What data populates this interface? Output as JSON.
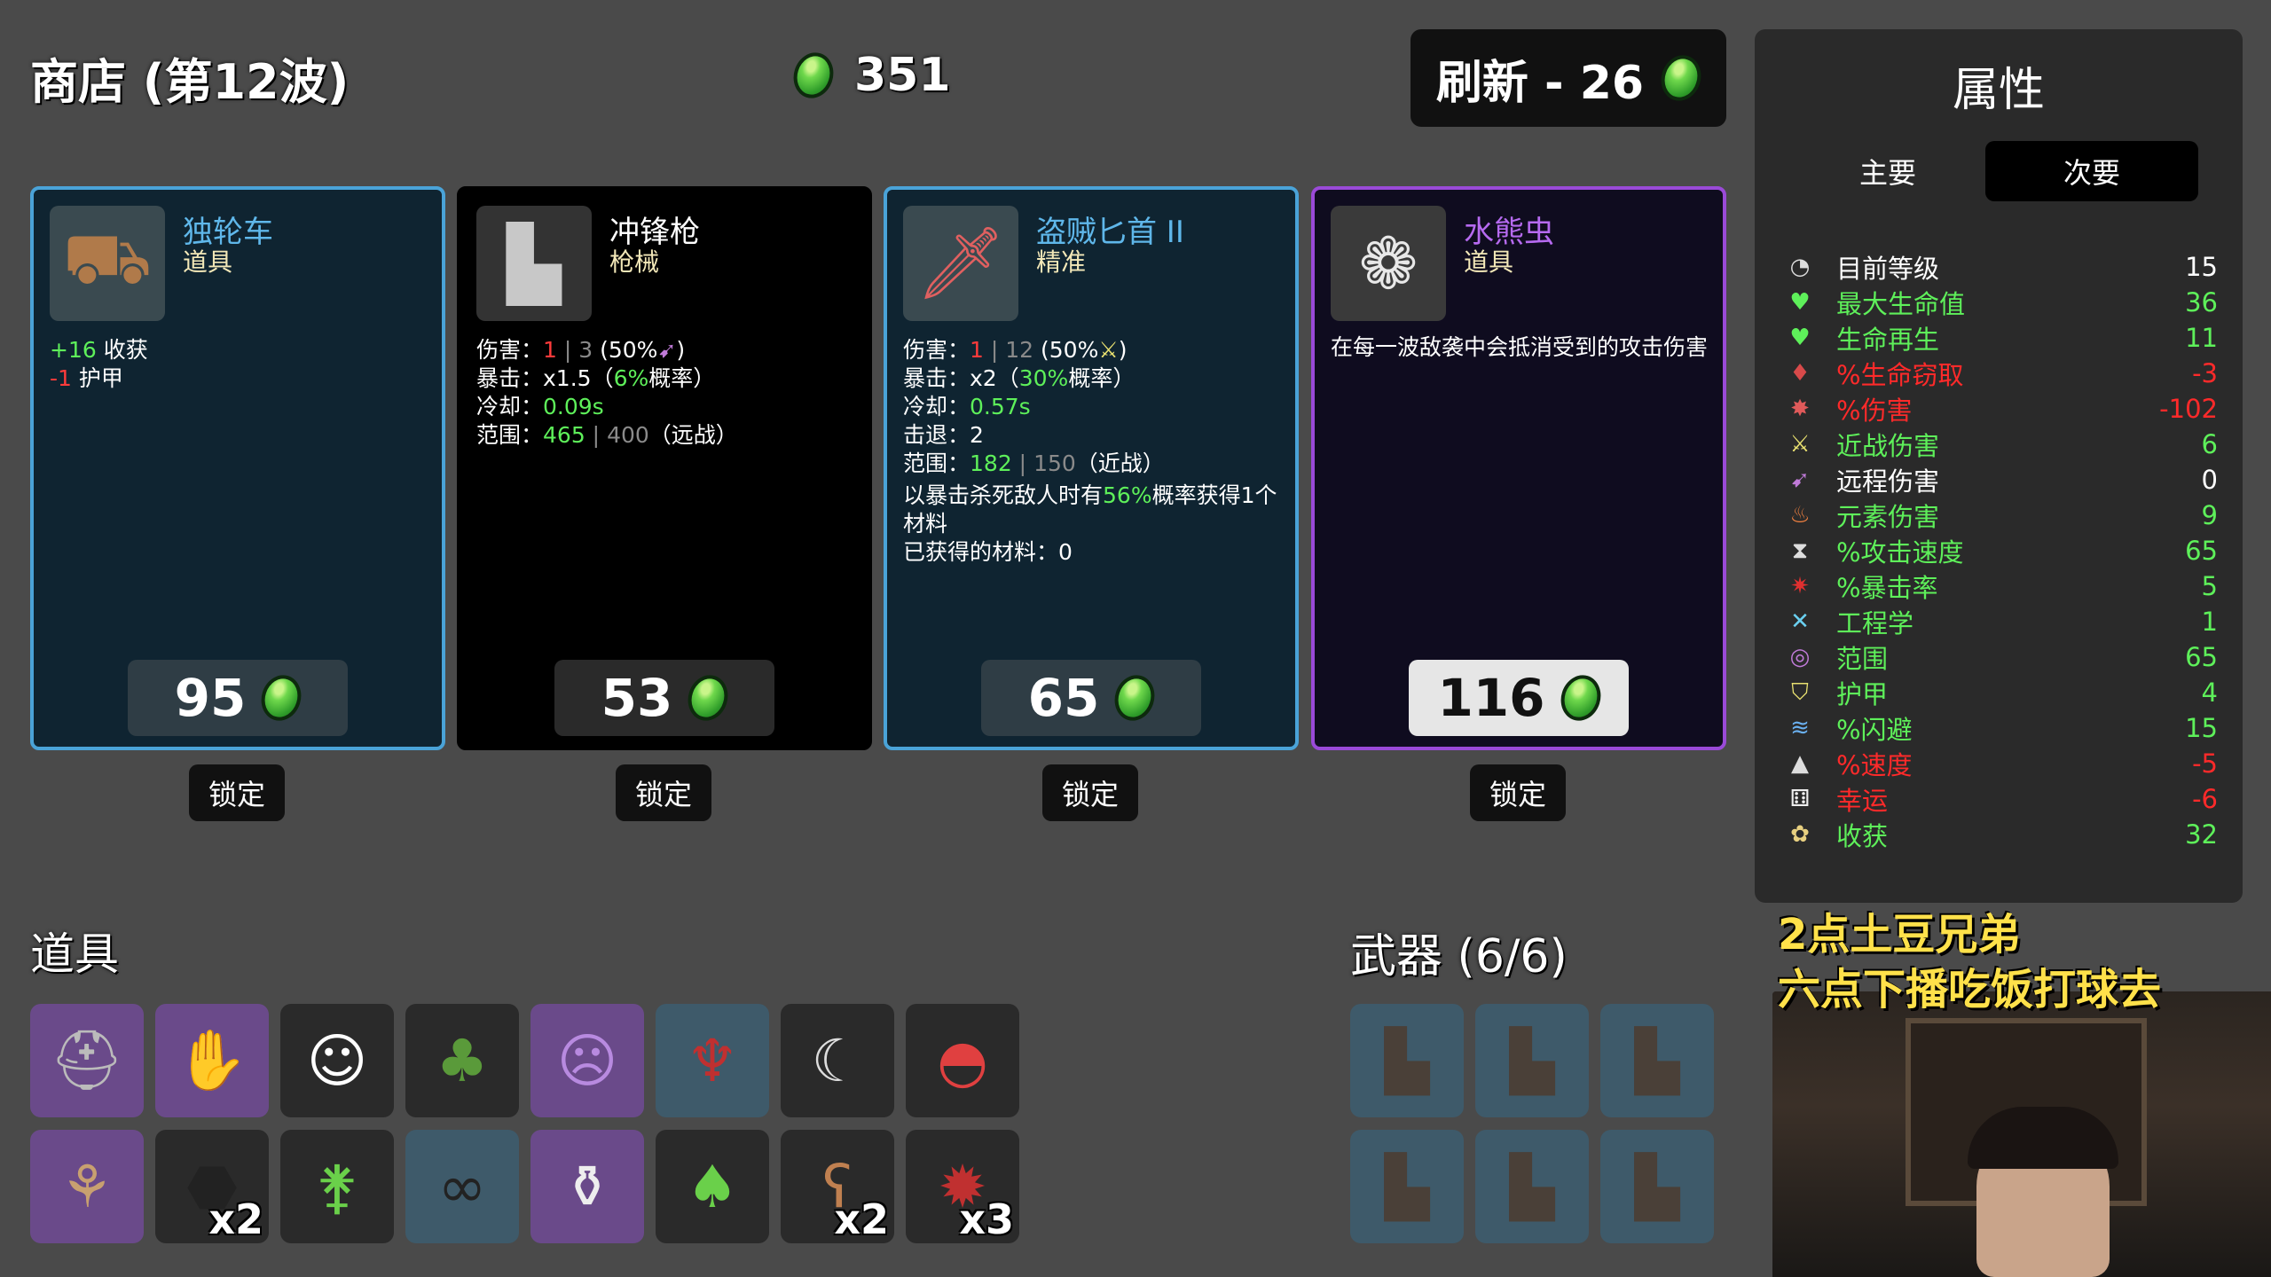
{
  "header": {
    "title": "商店 (第12波)",
    "gold": "351",
    "reroll_label": "刷新 - 26"
  },
  "shop": {
    "lock_label": "锁定",
    "cards": [
      {
        "name": "独轮车",
        "type": "道具",
        "price": "95",
        "icon": "wheelbarrow-icon",
        "lines": [
          {
            "a": "+16",
            "a_color": "green",
            "b": " 收获"
          },
          {
            "a": "-1",
            "a_color": "red",
            "b": " 护甲"
          }
        ]
      },
      {
        "name": "冲锋枪",
        "type": "枪械",
        "price": "53",
        "icon": "smg-icon",
        "lines": [
          {
            "label": "伤害：",
            "v1": "1",
            "v1c": "red",
            "sep": " | ",
            "v2": "3",
            "v2c": "gray",
            "rest": " (50%",
            "tail": ")"
          },
          {
            "label": "暴击：",
            "v1": "x1.5",
            "v1c": "white",
            "rest": "（",
            "v2": "6%",
            "v2c": "green",
            "tail": "概率）"
          },
          {
            "label": "冷却：",
            "v1": "0.09s",
            "v1c": "green"
          },
          {
            "label": "范围：",
            "v1": "465",
            "v1c": "green",
            "sep": " | ",
            "v2": "400",
            "v2c": "gray",
            "tail": "（远战）"
          }
        ]
      },
      {
        "name": "盗贼匕首 II",
        "type": "精准",
        "price": "65",
        "icon": "dagger-icon",
        "lines": [
          {
            "label": "伤害：",
            "v1": "1",
            "v1c": "red",
            "sep": " | ",
            "v2": "12",
            "v2c": "gray",
            "rest": " (50%",
            "tail": ")"
          },
          {
            "label": "暴击：",
            "v1": "x2",
            "v1c": "white",
            "rest": "（",
            "v2": "30%",
            "v2c": "green",
            "tail": "概率）"
          },
          {
            "label": "冷却：",
            "v1": "0.57s",
            "v1c": "green"
          },
          {
            "label": "击退：",
            "v1": "2",
            "v1c": "white"
          },
          {
            "label": "范围：",
            "v1": "182",
            "v1c": "green",
            "sep": " | ",
            "v2": "150",
            "v2c": "gray",
            "tail": "（近战）"
          }
        ],
        "extra_pre": "以暴击杀死敌人时有",
        "extra_pct": "56%",
        "extra_post": "概率获得1个材料",
        "extra2": "已获得的材料：0"
      },
      {
        "name": "水熊虫",
        "type": "道具",
        "price": "116",
        "icon": "tardigrade-icon",
        "desc": "在每一波敌袭中会抵消受到的攻击伤害"
      }
    ]
  },
  "stats": {
    "title": "属性",
    "tab_primary": "主要",
    "tab_secondary": "次要",
    "rows": [
      {
        "icon": "level-icon",
        "glyph": "◔",
        "label": "目前等级",
        "value": "15",
        "color": "#ffffff"
      },
      {
        "icon": "heart-icon",
        "glyph": "♥",
        "label": "最大生命值",
        "value": "36",
        "color": "#5ef05a"
      },
      {
        "icon": "regen-icon",
        "glyph": "♥",
        "label": "生命再生",
        "value": "11",
        "color": "#5ef05a"
      },
      {
        "icon": "lifesteal-icon",
        "glyph": "♦",
        "label": "%生命窃取",
        "value": "-3",
        "color": "#ff2a2a"
      },
      {
        "icon": "damage-icon",
        "glyph": "✸",
        "label": "%伤害",
        "value": "-102",
        "color": "#ff2a2a"
      },
      {
        "icon": "melee-icon",
        "glyph": "⚔",
        "label": "近战伤害",
        "value": "6",
        "color": "#5ef05a"
      },
      {
        "icon": "ranged-icon",
        "glyph": "➹",
        "label": "远程伤害",
        "value": "0",
        "color": "#ffffff"
      },
      {
        "icon": "elemental-icon",
        "glyph": "♨",
        "label": "元素伤害",
        "value": "9",
        "color": "#5ef05a"
      },
      {
        "icon": "attack-speed-icon",
        "glyph": "⧗",
        "label": "%攻击速度",
        "value": "65",
        "color": "#5ef05a"
      },
      {
        "icon": "crit-icon",
        "glyph": "✷",
        "label": "%暴击率",
        "value": "5",
        "color": "#5ef05a"
      },
      {
        "icon": "engineering-icon",
        "glyph": "✕",
        "label": "工程学",
        "value": "1",
        "color": "#5ef05a"
      },
      {
        "icon": "range-icon",
        "glyph": "◎",
        "label": "范围",
        "value": "65",
        "color": "#5ef05a"
      },
      {
        "icon": "armor-icon",
        "glyph": "⛉",
        "label": "护甲",
        "value": "4",
        "color": "#5ef05a"
      },
      {
        "icon": "dodge-icon",
        "glyph": "≋",
        "label": "%闪避",
        "value": "15",
        "color": "#5ef05a"
      },
      {
        "icon": "speed-icon",
        "glyph": "▲",
        "label": "%速度",
        "value": "-5",
        "color": "#ff2a2a"
      },
      {
        "icon": "luck-icon",
        "glyph": "⚅",
        "label": "幸运",
        "value": "-6",
        "color": "#ff2a2a"
      },
      {
        "icon": "harvesting-icon",
        "glyph": "✿",
        "label": "收获",
        "value": "32",
        "color": "#5ef05a"
      }
    ]
  },
  "items": {
    "title": "道具",
    "slots": [
      {
        "icon": "knight-helmet-icon",
        "glyph": "⛑",
        "style": "purple",
        "count": ""
      },
      {
        "icon": "gloves-icon",
        "glyph": "✋",
        "style": "purple",
        "count": ""
      },
      {
        "icon": "egg-mask-icon",
        "glyph": "☺",
        "style": "dark",
        "count": ""
      },
      {
        "icon": "tree-icon",
        "glyph": "♣",
        "style": "dark",
        "count": ""
      },
      {
        "icon": "ghost-icon",
        "glyph": "☹",
        "style": "purple",
        "count": ""
      },
      {
        "icon": "scarecrow-icon",
        "glyph": "♆",
        "style": "blue",
        "count": ""
      },
      {
        "icon": "crescent-icon",
        "glyph": "☾",
        "style": "dark",
        "count": ""
      },
      {
        "icon": "propeller-hat-icon",
        "glyph": "◓",
        "style": "dark",
        "count": ""
      },
      {
        "icon": "mushroom-plant-icon",
        "glyph": "⚘",
        "style": "purple",
        "count": ""
      },
      {
        "icon": "rock-icon",
        "glyph": "⬣",
        "style": "dark",
        "count": "x2"
      },
      {
        "icon": "sprout-icon",
        "glyph": "⚵",
        "style": "dark",
        "count": ""
      },
      {
        "icon": "black-belt-icon",
        "glyph": "∞",
        "style": "blue",
        "count": ""
      },
      {
        "icon": "bottle-icon",
        "glyph": "⚱",
        "style": "purple",
        "count": ""
      },
      {
        "icon": "seed-bag-icon",
        "glyph": "♠",
        "style": "dark",
        "count": ""
      },
      {
        "icon": "teddy-bear-icon",
        "glyph": "ʕ",
        "style": "dark",
        "count": "x2"
      },
      {
        "icon": "dynamite-icon",
        "glyph": "✹",
        "style": "dark",
        "count": "x3"
      }
    ]
  },
  "weapons": {
    "title": "武器 (6/6)",
    "slots": [
      {
        "icon": "smg-icon",
        "glyph": "▙"
      },
      {
        "icon": "smg-icon",
        "glyph": "▙"
      },
      {
        "icon": "smg-icon",
        "glyph": "▙"
      },
      {
        "icon": "smg-icon",
        "glyph": "▙"
      },
      {
        "icon": "smg-icon",
        "glyph": "▙"
      },
      {
        "icon": "smg-icon",
        "glyph": "▙"
      }
    ]
  },
  "stream_overlay": {
    "line1": "2点土豆兄弟",
    "line2": "六点下播吃饭打球去"
  },
  "colors": {
    "card_blue_border": "#4aa3d8",
    "card_purple_border": "#9a4ad8",
    "gem_green": "#5fd84a",
    "positive": "#5ef05a",
    "negative": "#ff2a2a"
  }
}
